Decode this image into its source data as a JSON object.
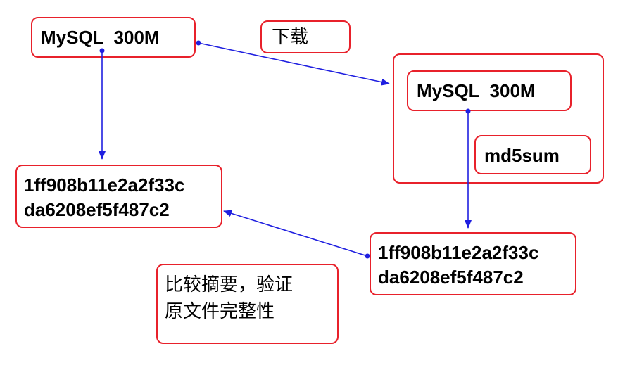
{
  "colors": {
    "box_border": "#e8212b",
    "arrow": "#1f1fe0",
    "text": "#000000"
  },
  "diagram": {
    "source_file_label": "MySQL  300M",
    "download_label": "下载",
    "downloaded_file_label": "MySQL  300M",
    "tool_label": "md5sum",
    "original_digest_line1": "1ff908b11e2a2f33c",
    "original_digest_line2": "da6208ef5f487c2",
    "computed_digest_line1": "1ff908b11e2a2f33c",
    "computed_digest_line2": "da6208ef5f487c2",
    "note_line1": "比较摘要，验证",
    "note_line2": "原文件完整性"
  }
}
